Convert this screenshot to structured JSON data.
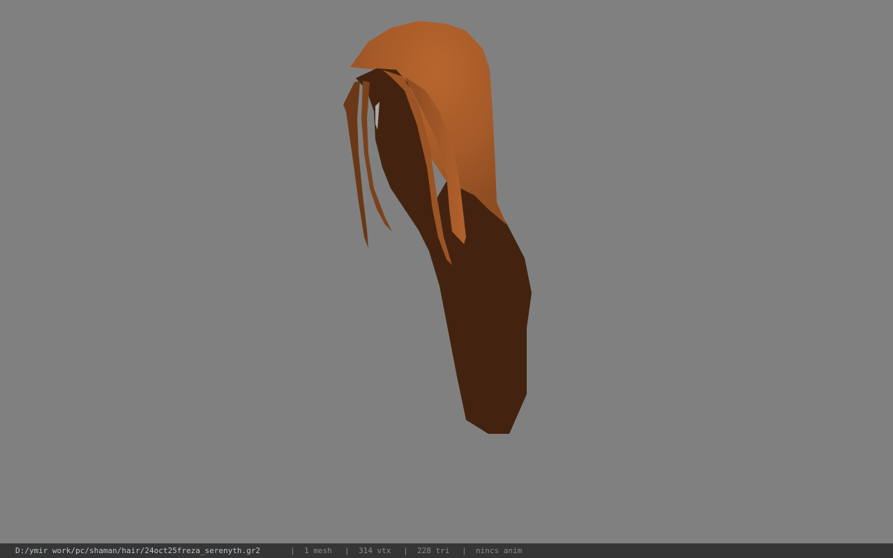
{
  "viewer": {
    "background_color": "#808080",
    "model": {
      "description_icon": "hair-mesh",
      "colors": {
        "highlight": "#b0622c",
        "midtone": "#8a4a22",
        "shadow": "#43230f"
      }
    }
  },
  "status_bar": {
    "file_path": "D:/ymir work/pc/shaman/hair/24oct25freza_serenyth.gr2",
    "separator": "|",
    "mesh_count": "1 mesh",
    "vertex_count": "314 vtx",
    "triangle_count": "228 tri",
    "anim_status": "nincs anim",
    "background_color": "#353535"
  }
}
